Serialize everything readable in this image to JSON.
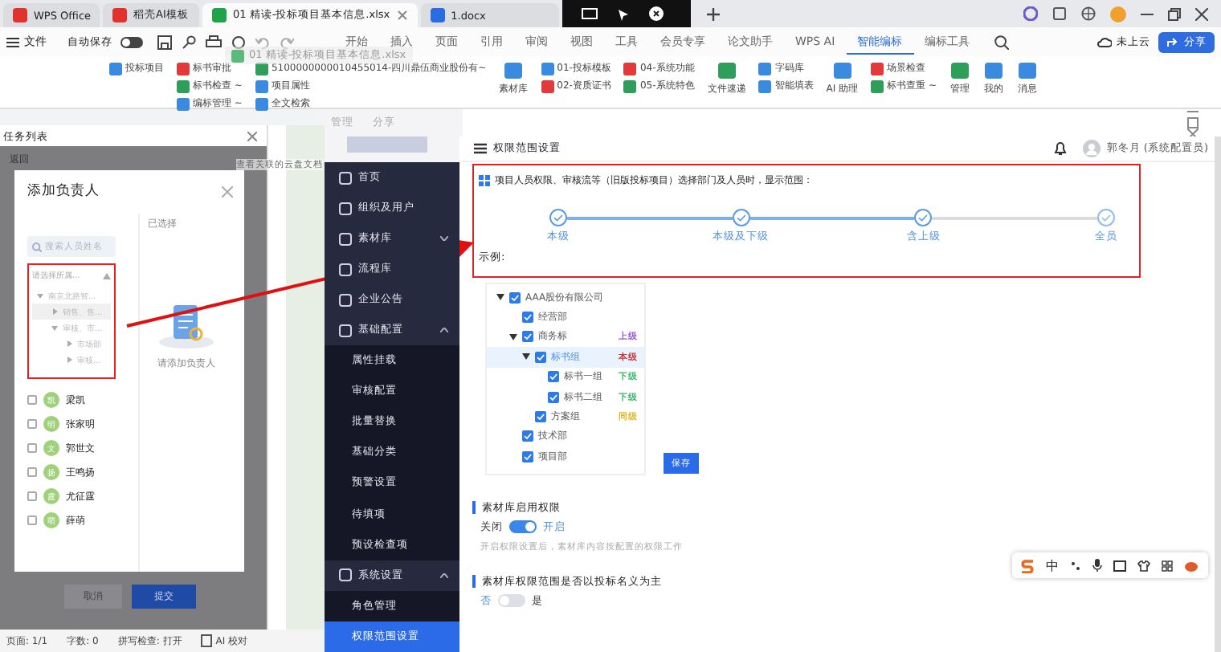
{
  "tabs": [
    {
      "label": "WPS Office",
      "kind": "wps",
      "selected": false
    },
    {
      "label": "稻壳AI模板",
      "kind": "app",
      "selected": false
    },
    {
      "label": "01 精读-投标项目基本信息.xlsx",
      "kind": "sheet",
      "selected": true
    },
    {
      "label": "1.docx",
      "kind": "doc",
      "selected": false
    }
  ],
  "menu": {
    "file": "文件",
    "autosave": {
      "label": "自动保存",
      "on": false
    },
    "items": [
      {
        "label": "开始",
        "selected": false
      },
      {
        "label": "插入",
        "selected": false
      },
      {
        "label": "页面",
        "selected": false
      },
      {
        "label": "引用",
        "selected": false
      },
      {
        "label": "审阅",
        "selected": false
      },
      {
        "label": "视图",
        "selected": false
      },
      {
        "label": "工具",
        "selected": false
      },
      {
        "label": "会员专享",
        "selected": false
      },
      {
        "label": "论文助手",
        "selected": false
      },
      {
        "label": "WPS AI",
        "selected": false
      },
      {
        "label": "智能编标",
        "selected": true
      },
      {
        "label": "编标工具",
        "selected": false
      }
    ],
    "cloud": "未上云",
    "share": "分享"
  },
  "drag_ghost": "01 精读-投标项目基本信息.xlsx",
  "ribbon": {
    "columns": [
      [
        "投标项目"
      ],
      [
        "标书审批",
        "标书检查 ~",
        "编标管理 ~"
      ],
      [
        "5100000000010455014-四川鼎伍商业股份有~",
        "项目属性",
        "全文检索"
      ],
      [
        "素材库"
      ],
      [
        "01-投标模板",
        "02-资质证书"
      ],
      [
        "04-系统功能",
        "05-系统特色"
      ],
      [
        "文件速递"
      ],
      [
        "字码库",
        "智能填表"
      ],
      [
        "AI 助理"
      ],
      [
        "场景检查",
        "标书查重 ~"
      ],
      [
        "管理"
      ],
      [
        "我的"
      ],
      [
        "消息"
      ]
    ]
  },
  "background_window": {
    "labels": [
      "管理",
      "分享"
    ],
    "notice": "查看关联的云盘文档"
  },
  "task_pane": {
    "title": "任务列表",
    "back": "返回",
    "dialog": {
      "title": "添加负责人",
      "search_placeholder": "搜索人员姓名",
      "dropdown_placeholder": "请选择所属...",
      "tree": [
        {
          "label": "南京北路智...",
          "expanded": true,
          "selected": false,
          "children": [
            {
              "label": "销售、售...",
              "expanded": false,
              "selected": true
            },
            {
              "label": "审核、市...",
              "expanded": true,
              "selected": false,
              "children": [
                {
                  "label": "市场部",
                  "expanded": false,
                  "selected": false
                },
                {
                  "label": "审核...",
                  "expanded": false,
                  "selected": false
                }
              ]
            }
          ]
        }
      ],
      "selected_label": "已选择",
      "empty_text": "请添加负责人",
      "people": [
        {
          "initial": "凯",
          "name": "梁凯",
          "checked": false
        },
        {
          "initial": "明",
          "name": "张家明",
          "checked": false
        },
        {
          "initial": "文",
          "name": "郭世文",
          "checked": false
        },
        {
          "initial": "扬",
          "name": "王鸣扬",
          "checked": false
        },
        {
          "initial": "霆",
          "name": "尤征霆",
          "checked": false
        },
        {
          "initial": "萌",
          "name": "薛萌",
          "checked": false
        }
      ]
    },
    "cancel": "取消",
    "submit": "提交"
  },
  "status_bar": [
    "页面: 1/1",
    "字数: 0",
    "拼写检查: 打开",
    "AI 校对"
  ],
  "sidebar": [
    {
      "label": "首页",
      "kind": "group",
      "selected": false
    },
    {
      "label": "组织及用户",
      "kind": "group",
      "selected": false
    },
    {
      "label": "素材库",
      "kind": "group",
      "expanded": false,
      "selected": false
    },
    {
      "label": "流程库",
      "kind": "group",
      "selected": false
    },
    {
      "label": "企业公告",
      "kind": "group",
      "selected": false
    },
    {
      "label": "基础配置",
      "kind": "group",
      "expanded": true,
      "selected": false
    },
    {
      "label": "属性挂载",
      "kind": "sub",
      "selected": false
    },
    {
      "label": "审核配置",
      "kind": "sub",
      "selected": false
    },
    {
      "label": "批量替换",
      "kind": "sub",
      "selected": false
    },
    {
      "label": "基础分类",
      "kind": "sub",
      "selected": false
    },
    {
      "label": "预警设置",
      "kind": "sub",
      "selected": false
    },
    {
      "label": "待填项",
      "kind": "sub",
      "selected": false
    },
    {
      "label": "预设检查项",
      "kind": "sub",
      "selected": false
    },
    {
      "label": "系统设置",
      "kind": "group",
      "expanded": true,
      "selected": false
    },
    {
      "label": "角色管理",
      "kind": "sub",
      "selected": false
    },
    {
      "label": "权限范围设置",
      "kind": "sub",
      "selected": true
    }
  ],
  "header": {
    "title": "权限范围设置",
    "user": "郭冬月 (系统配置员)"
  },
  "scope": {
    "description": "项目人员权限、审核流等（旧版投标项目）选择部门及人员时，显示范围：",
    "steps": [
      {
        "label": "本级",
        "reached": true
      },
      {
        "label": "本级及下级",
        "reached": true
      },
      {
        "label": "含上级",
        "reached": true
      },
      {
        "label": "全员",
        "reached": false
      }
    ],
    "example_label": "示例:",
    "tree": [
      {
        "label": "AAA股份有限公司",
        "checked": true,
        "expanded": true,
        "children": [
          {
            "label": "经营部",
            "checked": true
          },
          {
            "label": "商务标",
            "checked": true,
            "expanded": true,
            "tag": {
              "text": "上级",
              "color": "#9b5bd6"
            },
            "children": [
              {
                "label": "标书组",
                "checked": true,
                "expanded": true,
                "highlighted": true,
                "tag": {
                  "text": "本级",
                  "color": "#d2323a"
                },
                "children": [
                  {
                    "label": "标书一组",
                    "checked": true,
                    "tag": {
                      "text": "下级",
                      "color": "#3dba6a"
                    }
                  },
                  {
                    "label": "标书二组",
                    "checked": true,
                    "tag": {
                      "text": "下级",
                      "color": "#3dba6a"
                    }
                  }
                ]
              },
              {
                "label": "方案组",
                "checked": true,
                "tag": {
                  "text": "同级",
                  "color": "#e6b422"
                }
              }
            ]
          },
          {
            "label": "技术部",
            "checked": true
          },
          {
            "label": "项目部",
            "checked": true
          }
        ]
      }
    ],
    "save": "保存"
  },
  "settings": [
    {
      "title": "素材库启用权限",
      "off_label": "关闭",
      "on_label": "开启",
      "on": true,
      "hint": "开启权限设置后，素材库内容按配置的权限工作"
    },
    {
      "title": "素材库权限范围是否以投标名义为主",
      "off_label": "否",
      "on_label": "是",
      "on": false
    }
  ],
  "ime": {
    "mode": "中"
  }
}
